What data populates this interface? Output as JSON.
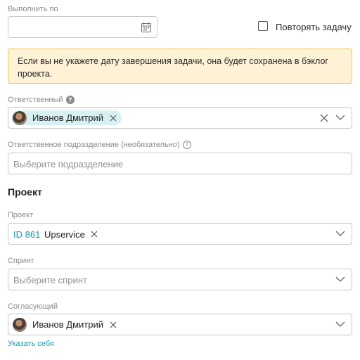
{
  "due_date": {
    "label": "Выполнить по",
    "value": "",
    "icon": "calendar-icon"
  },
  "repeat": {
    "label": "Повторять задачу",
    "checked": false
  },
  "backlog_notice": {
    "text": "Если вы не укажете дату завершения задачи, она будет сохранена в бэклог проекта.",
    "background": "#fdf1d6",
    "border": "#f1c45b"
  },
  "assignee": {
    "label": "Ответственный",
    "help": "?",
    "selected_name": "Иванов Дмитрий",
    "tag_color": "#d7f1f3"
  },
  "department": {
    "label": "Ответственное подразделение (необязательно)",
    "help": "?",
    "placeholder": "Выберите подразделение"
  },
  "project_section": {
    "title": "Проект"
  },
  "project": {
    "label": "Проект",
    "id_text": "ID 861",
    "name": "Upservice",
    "id_color": "#1a9ba8"
  },
  "sprint": {
    "label": "Спринт",
    "placeholder": "Выберите спринт"
  },
  "approver": {
    "label": "Согласующий",
    "selected_name": "Иванов Дмитрий",
    "assign_self_link": "Указать себя",
    "link_color": "#1a9ba8"
  }
}
